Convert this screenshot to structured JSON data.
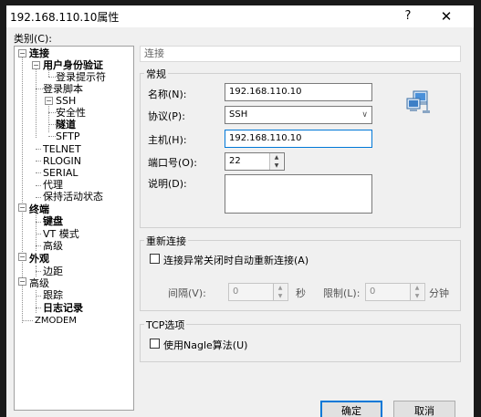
{
  "window": {
    "title": "192.168.110.10属性",
    "help_glyph": "?",
    "close_glyph": "✕"
  },
  "category_label": "类别(C):",
  "tree": {
    "nodes": [
      {
        "label": "连接",
        "bold": true,
        "expander": "−"
      },
      {
        "label": "用户身份验证",
        "bold": true,
        "expander": "−"
      },
      {
        "label": "登录提示符",
        "bold": false
      },
      {
        "label": "登录脚本",
        "bold": false
      },
      {
        "label": "SSH",
        "bold": false,
        "expander": "−"
      },
      {
        "label": "安全性",
        "bold": false
      },
      {
        "label": "隧道",
        "bold": true
      },
      {
        "label": "SFTP",
        "bold": false
      },
      {
        "label": "TELNET",
        "bold": false
      },
      {
        "label": "RLOGIN",
        "bold": false
      },
      {
        "label": "SERIAL",
        "bold": false
      },
      {
        "label": "代理",
        "bold": false
      },
      {
        "label": "保持活动状态",
        "bold": false
      },
      {
        "label": "终端",
        "bold": true,
        "expander": "−"
      },
      {
        "label": "键盘",
        "bold": true
      },
      {
        "label": "VT 模式",
        "bold": false
      },
      {
        "label": "高级",
        "bold": false
      },
      {
        "label": "外观",
        "bold": true,
        "expander": "−"
      },
      {
        "label": "边距",
        "bold": false
      },
      {
        "label": "高级",
        "bold": false,
        "expander": "−"
      },
      {
        "label": "跟踪",
        "bold": false
      },
      {
        "label": "日志记录",
        "bold": true
      },
      {
        "label": "ZMODEM",
        "bold": false
      }
    ]
  },
  "section_header": "连接",
  "general": {
    "title": "常规",
    "name_label": "名称(N):",
    "name_value": "192.168.110.10",
    "protocol_label": "协议(P):",
    "protocol_value": "SSH",
    "host_label": "主机(H):",
    "host_value": "192.168.110.10",
    "port_label": "端口号(O):",
    "port_value": "22",
    "desc_label": "说明(D):",
    "desc_value": "",
    "icon": "network-computers-icon"
  },
  "reconnect": {
    "title": "重新连接",
    "checkbox_label": "连接异常关闭时自动重新连接(A)",
    "interval_label": "间隔(V):",
    "interval_value": "0",
    "interval_unit": "秒",
    "limit_label": "限制(L):",
    "limit_value": "0",
    "limit_unit": "分钟"
  },
  "tcp": {
    "title": "TCP选项",
    "nagle_label": "使用Nagle算法(U)"
  },
  "buttons": {
    "ok": "确定",
    "cancel": "取消"
  },
  "colors": {
    "accent": "#0078d7",
    "dialog_bg": "#f0f0f0"
  }
}
